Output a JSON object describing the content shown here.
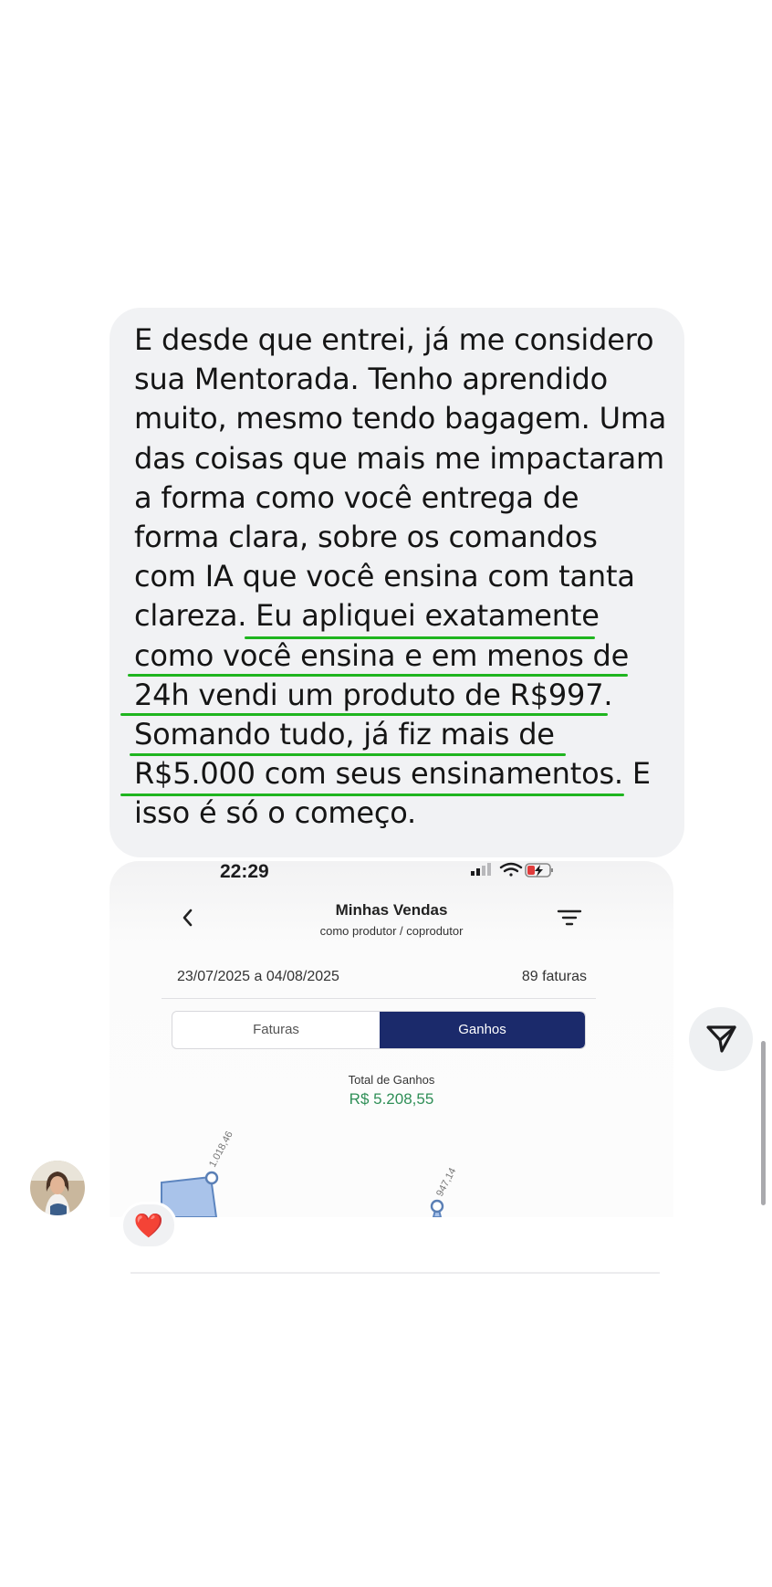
{
  "message": {
    "lines": [
      "E desde que entrei, já me considero",
      "sua Mentorada. Tenho aprendido",
      "muito, mesmo tendo bagagem. Uma",
      "das coisas que mais me impactaram",
      "a forma como você entrega de",
      "forma clara, sobre os comandos",
      "com IA que você ensina com tanta",
      "clareza. Eu apliquei exatamente",
      "como você ensina e em menos de",
      "24h vendi um produto de R$997.",
      "Somando tudo, já fiz mais de",
      "R$5.000 com seus ensinamentos. E",
      "isso é só o começo."
    ],
    "highlight_color": "#1fb51f",
    "bubble_color": "#f1f2f4"
  },
  "reaction": {
    "emoji": "❤️",
    "icon": "heart-icon"
  },
  "attachment": {
    "status_bar": {
      "time": "22:29",
      "icons": [
        "signal-icon",
        "wifi-icon",
        "battery-charging-icon"
      ]
    },
    "header": {
      "title": "Minhas Vendas",
      "subtitle": "como produtor / coprodutor",
      "back_icon": "chevron-left-icon",
      "filter_icon": "filter-icon"
    },
    "date_range": "23/07/2025 a 04/08/2025",
    "invoice_count": "89 faturas",
    "tabs": [
      {
        "label": "Faturas",
        "active": false
      },
      {
        "label": "Ganhos",
        "active": true
      }
    ],
    "total_label": "Total de Ganhos",
    "total_value": "R$ 5.208,55",
    "accent_color": "#1b2a6b",
    "value_color": "#2f8f57",
    "chart_data": {
      "type": "area",
      "visible_points": [
        {
          "label": "1.018,46",
          "value": 1018.46
        },
        {
          "label": "947,14",
          "value": 947.14
        }
      ]
    }
  },
  "share_button": {
    "icon": "send-icon"
  },
  "avatar": {
    "icon": "user-avatar"
  }
}
